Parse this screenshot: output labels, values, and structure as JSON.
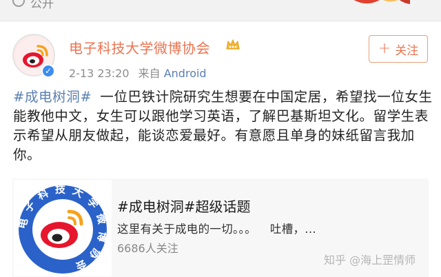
{
  "header": {
    "visibility_label": "公开"
  },
  "post": {
    "author": "电子科技大学微博协会",
    "timestamp": "2-13 23:20",
    "source_prefix": "来自",
    "source_name": "Android",
    "follow_label": "关注",
    "hashtag": "#成电树洞#",
    "body": "一位巴铁计院研究生想要在中国定居，希望找一位女生能教他中文，女生可以跟他学习英语，了解巴基斯坦文化。留学生表示希望从朋友做起，能谈恋爱最好。有意愿且单身的妹纸留言我加你。"
  },
  "topic_card": {
    "title": "#成电树洞#超级话题",
    "description": "这里有关于成电的一切。。。",
    "description_more": "吐槽，...",
    "followers": "6686人关注",
    "badge_text": "电子科技大学微博协会"
  },
  "watermark": "知乎 @海上罡情师",
  "colors": {
    "accent": "#eb7350",
    "link": "#5b7fb3",
    "verified": "#3d8cf0"
  },
  "icons": [
    "lock-icon",
    "verified-icon",
    "crown-icon",
    "weibo-logo-icon"
  ]
}
